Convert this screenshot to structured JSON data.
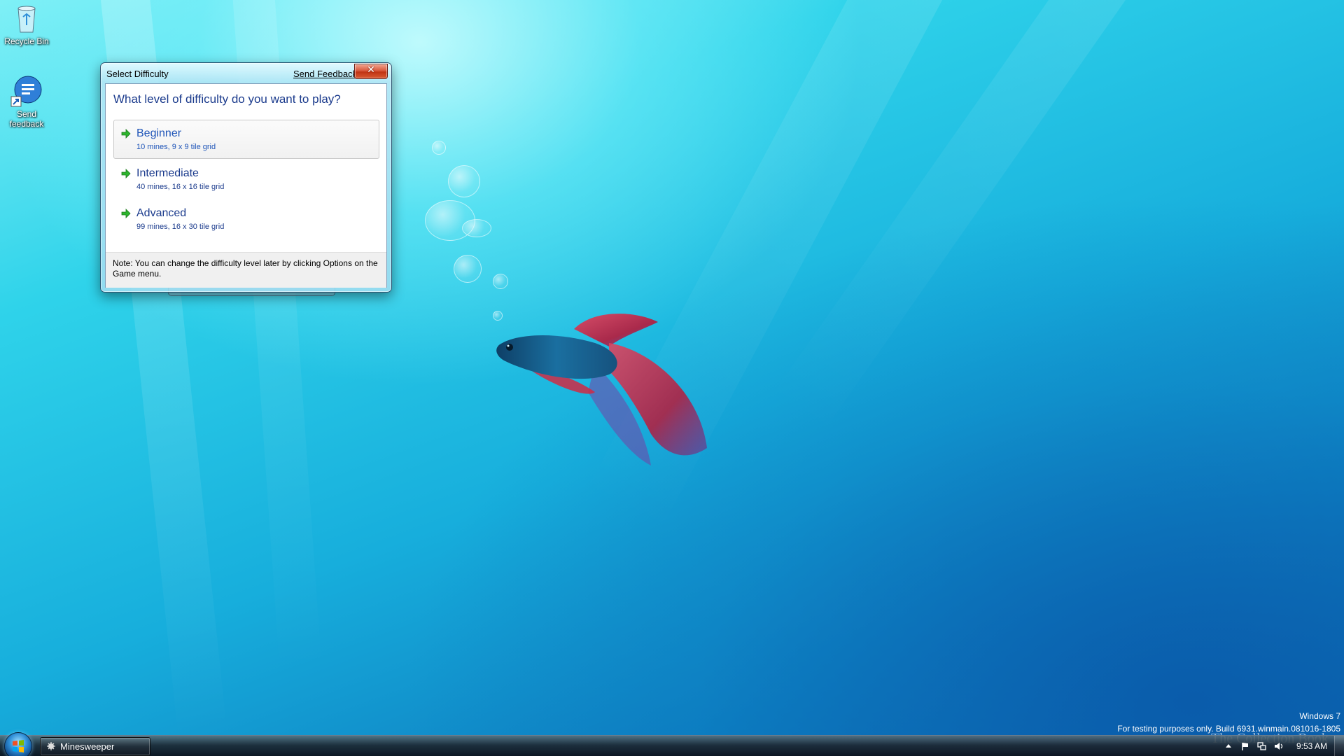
{
  "desktop": {
    "icons": [
      {
        "label": "Recycle Bin",
        "icon": "recycle-bin-icon"
      },
      {
        "label": "Send feedback",
        "icon": "send-feedback-icon"
      }
    ]
  },
  "dialog": {
    "title": "Select Difficulty",
    "feedback_link": "Send Feedback",
    "close_symbol": "✕",
    "question": "What level of difficulty do you want to play?",
    "options": [
      {
        "title": "Beginner",
        "desc": "10 mines, 9 x 9 tile grid",
        "selected": true
      },
      {
        "title": "Intermediate",
        "desc": "40 mines, 16 x 16 tile grid",
        "selected": false
      },
      {
        "title": "Advanced",
        "desc": "99 mines, 16 x 30 tile grid",
        "selected": false
      }
    ],
    "note": "Note: You can change the difficulty level later by clicking Options on the Game menu."
  },
  "watermark": {
    "os_name": "Windows 7",
    "build_text": "For testing purposes only. Build 6931.winmain.081016-1805",
    "site_mark": "The Collection Book"
  },
  "taskbar": {
    "task_label": "Minesweeper",
    "clock": "9:53 AM",
    "colors": {
      "accent": "#1a3a8c",
      "close": "#c03414"
    }
  }
}
